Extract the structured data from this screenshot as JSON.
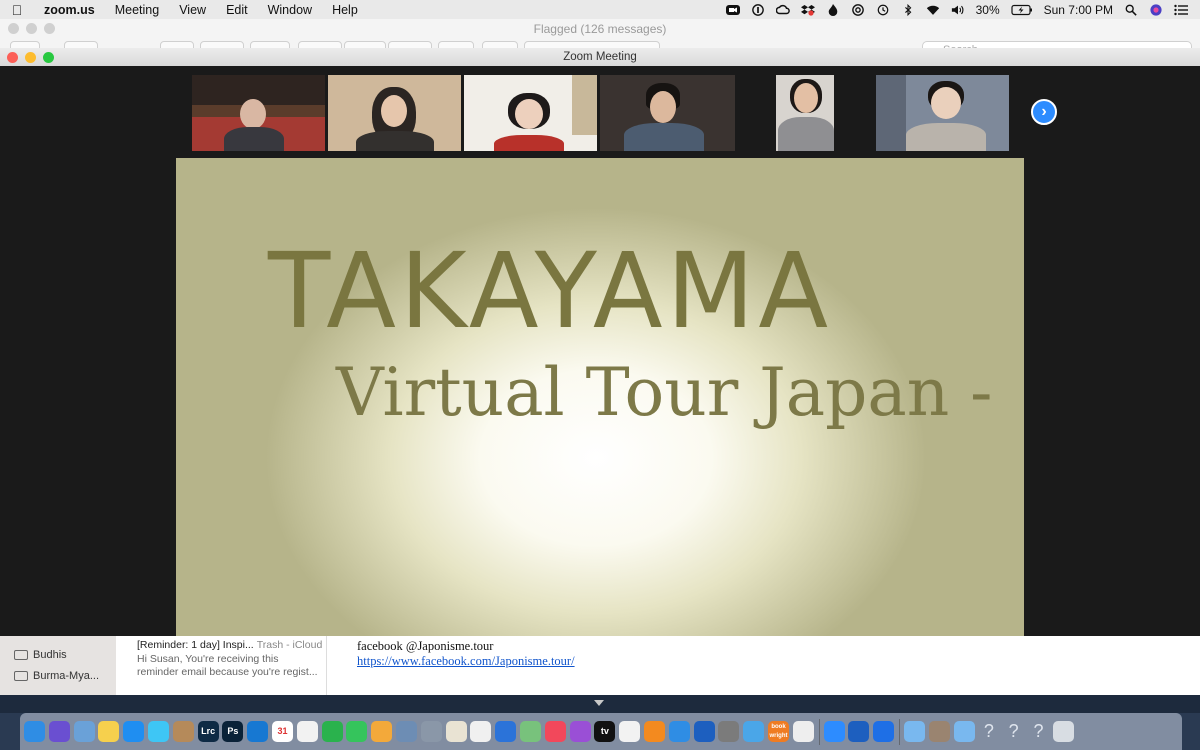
{
  "menubar": {
    "app_name": "zoom.us",
    "items": [
      "Meeting",
      "View",
      "Edit",
      "Window",
      "Help"
    ],
    "battery": "30%",
    "clock": "Sun 7:00 PM",
    "status_icons": [
      "zoom-icon",
      "1password-icon",
      "creative-cloud-icon",
      "dropbox-icon",
      "flame-icon",
      "o-icon",
      "time-machine-icon",
      "bluetooth-icon",
      "wifi-icon",
      "volume-icon",
      "battery-icon",
      "search-icon",
      "siri-icon",
      "control-list-icon"
    ]
  },
  "mail": {
    "window_title": "Flagged (126 messages)",
    "search_placeholder": "Search",
    "sidebar": [
      {
        "label": "Budhis"
      },
      {
        "label": "Burma-Mya..."
      }
    ],
    "message": {
      "subject": "[Reminder: 1 day] Inspi...",
      "mailbox": "Trash - iCloud",
      "preview": "Hi Susan, You're receiving this reminder email because you're regist..."
    },
    "body": {
      "facebook_line": "facebook @Japonisme.tour",
      "link": "https://www.facebook.com/Japonisme.tour/"
    }
  },
  "zoom": {
    "window_title": "Zoom Meeting",
    "participants": [
      {
        "tile": "participant-1",
        "bg": "#6b4a33"
      },
      {
        "tile": "participant-2",
        "bg": "#cdb79a"
      },
      {
        "tile": "participant-3",
        "bg": "#f2efe8"
      },
      {
        "tile": "participant-4",
        "bg": "#3a3430"
      },
      {
        "tile": "participant-5",
        "bg": "#d9d4cf"
      },
      {
        "tile": "participant-6",
        "bg": "#7f8a9a"
      }
    ],
    "shared_screen": {
      "title": "TAKAYAMA",
      "subtitle": "Virtual Tour Japan -"
    }
  },
  "dock": {
    "apps": [
      {
        "name": "finder",
        "color": "#2f8de4",
        "label": ""
      },
      {
        "name": "siri",
        "color": "#6a4fd1",
        "label": ""
      },
      {
        "name": "preview",
        "color": "#6aa1d8",
        "label": ""
      },
      {
        "name": "notes",
        "color": "#f6d04d",
        "label": ""
      },
      {
        "name": "safari",
        "color": "#1f8ef1",
        "label": ""
      },
      {
        "name": "messages",
        "color": "#3ec6f5",
        "label": ""
      },
      {
        "name": "contacts",
        "color": "#b58a5a",
        "label": ""
      },
      {
        "name": "lightroom",
        "color": "#0e2a44",
        "label": "Lrc"
      },
      {
        "name": "photoshop",
        "color": "#0a2238",
        "label": "Ps"
      },
      {
        "name": "trello",
        "color": "#1778d2",
        "label": ""
      },
      {
        "name": "calendar",
        "color": "#ffffff",
        "label": "31"
      },
      {
        "name": "reminders",
        "color": "#f2f2f2",
        "label": ""
      },
      {
        "name": "evernote",
        "color": "#2ab24d",
        "label": ""
      },
      {
        "name": "facetime",
        "color": "#35c45c",
        "label": ""
      },
      {
        "name": "photos",
        "color": "#f3a93a",
        "label": ""
      },
      {
        "name": "image-capture",
        "color": "#6d8db4",
        "label": ""
      },
      {
        "name": "launchpad",
        "color": "#8a97a8",
        "label": ""
      },
      {
        "name": "textedit",
        "color": "#e9e3d3",
        "label": ""
      },
      {
        "name": "chrome",
        "color": "#f0f0f0",
        "label": ""
      },
      {
        "name": "keynote",
        "color": "#2b73d9",
        "label": ""
      },
      {
        "name": "maps",
        "color": "#78c27c",
        "label": ""
      },
      {
        "name": "music",
        "color": "#f2485b",
        "label": ""
      },
      {
        "name": "podcasts",
        "color": "#9a4fd6",
        "label": ""
      },
      {
        "name": "tv",
        "color": "#111111",
        "label": "tv"
      },
      {
        "name": "news",
        "color": "#f2f2f2",
        "label": ""
      },
      {
        "name": "books",
        "color": "#f38a1f",
        "label": ""
      },
      {
        "name": "app-store",
        "color": "#2f8de4",
        "label": ""
      },
      {
        "name": "1password",
        "color": "#1d5fbf",
        "label": ""
      },
      {
        "name": "system-preferences",
        "color": "#7b7b7b",
        "label": ""
      },
      {
        "name": "blocker",
        "color": "#4aa6e8",
        "label": ""
      },
      {
        "name": "book-wright",
        "color": "#ef7c22",
        "label": "book wright"
      },
      {
        "name": "scanner",
        "color": "#eeeeee",
        "label": ""
      },
      {
        "name": "zoom",
        "color": "#2d8cff",
        "label": ""
      },
      {
        "name": "1password-mini",
        "color": "#1d5fbf",
        "label": ""
      },
      {
        "name": "dropbox",
        "color": "#1e6fe6",
        "label": ""
      },
      {
        "name": "folder-downloads",
        "color": "#79b8ef",
        "label": ""
      },
      {
        "name": "archive",
        "color": "#9a8470",
        "label": ""
      },
      {
        "name": "folder-documents",
        "color": "#79b8ef",
        "label": ""
      },
      {
        "name": "unknown-1",
        "color": "transparent",
        "label": "?"
      },
      {
        "name": "unknown-2",
        "color": "transparent",
        "label": "?"
      },
      {
        "name": "unknown-3",
        "color": "transparent",
        "label": "?"
      },
      {
        "name": "trash",
        "color": "#d8dde3",
        "label": ""
      }
    ]
  }
}
